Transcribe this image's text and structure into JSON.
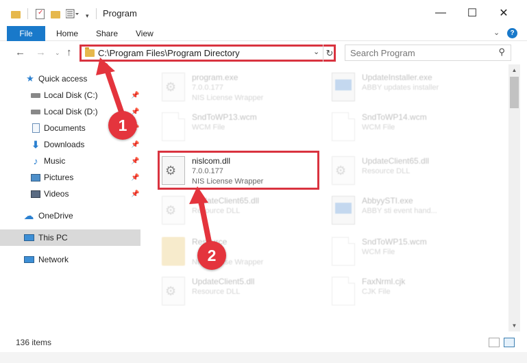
{
  "window": {
    "title": "Program",
    "minimize_glyph": "—",
    "maximize_glyph": "☐",
    "close_glyph": "✕"
  },
  "ribbon": {
    "file_label": "File",
    "tabs": [
      "Home",
      "Share",
      "View"
    ],
    "expand_glyph": "⌄",
    "help_glyph": "?"
  },
  "address": {
    "path": "C:\\Program Files\\Program Directory",
    "search_placeholder": "Search Program"
  },
  "sidebar": {
    "items": [
      {
        "label": "Quick access",
        "icon": "star-icon"
      },
      {
        "label": "Local Disk (C:)",
        "icon": "drive-icon",
        "pinned": true
      },
      {
        "label": "Local Disk (D:)",
        "icon": "drive-icon",
        "pinned": true
      },
      {
        "label": "Documents",
        "icon": "documents-icon",
        "pinned": true
      },
      {
        "label": "Downloads",
        "icon": "download-icon",
        "pinned": true
      },
      {
        "label": "Music",
        "icon": "music-icon",
        "pinned": true
      },
      {
        "label": "Pictures",
        "icon": "pictures-icon",
        "pinned": true
      },
      {
        "label": "Videos",
        "icon": "videos-icon",
        "pinned": true
      },
      {
        "label": "OneDrive",
        "icon": "cloud-icon"
      },
      {
        "label": "This PC",
        "icon": "computer-icon"
      },
      {
        "label": "Network",
        "icon": "network-icon"
      }
    ]
  },
  "files": [
    {
      "name": "program.exe",
      "line1": "7.0.0.177",
      "line2": "NIS License Wrapper",
      "icon": "exe-icon"
    },
    {
      "name": "UpdateInstaller.exe",
      "line1": "ABBY updates installer",
      "line2": "",
      "icon": "app-icon"
    },
    {
      "name": "SndToWP13.wcm",
      "line1": "WCM File",
      "line2": "",
      "icon": "file-icon"
    },
    {
      "name": "SndToWP14.wcm",
      "line1": "WCM File",
      "line2": "",
      "icon": "file-icon"
    },
    {
      "name": "nislcom.dll",
      "line1": "7.0.0.177",
      "line2": "NIS License Wrapper",
      "icon": "dll-icon"
    },
    {
      "name": "UpdateClient65.dll",
      "line1": "Resource DLL",
      "line2": "",
      "icon": "dll-icon"
    },
    {
      "name": "UpdateClient65.dll",
      "line1": "Resource DLL",
      "line2": "",
      "icon": "dll-icon"
    },
    {
      "name": "AbbyySTI.exe",
      "line1": "ABBY sti event hand...",
      "line2": "",
      "icon": "app-icon"
    },
    {
      "name": "Resource",
      "line1": "",
      "line2": "NIS License Wrapper",
      "icon": "folder-icon"
    },
    {
      "name": "SndToWP15.wcm",
      "line1": "WCM File",
      "line2": "",
      "icon": "file-icon"
    },
    {
      "name": "UpdateClient5.dll",
      "line1": "Resource DLL",
      "line2": "",
      "icon": "dll-icon"
    },
    {
      "name": "FaxNrml.cjk",
      "line1": "CJK File",
      "line2": "",
      "icon": "file-icon"
    }
  ],
  "status": {
    "count": "136 items"
  },
  "callouts": {
    "step1": "1",
    "step2": "2"
  },
  "colors": {
    "accent": "#1979ca",
    "highlight_red": "#d9333f",
    "badge_red": "#e4343d"
  }
}
